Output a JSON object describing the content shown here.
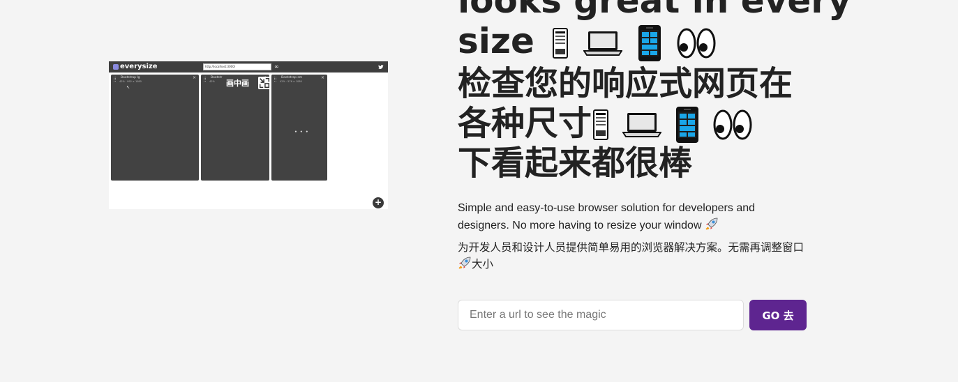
{
  "preview": {
    "logo": "everysize",
    "url": "http://localhost:3000/",
    "link_icon": "∞",
    "pip_label": "画中画",
    "add_label": "+",
    "cursor": "↖",
    "dots": "• • •",
    "panels": [
      {
        "name": "Bootstrap lg",
        "dims": "42%  ·  992  ×  1080",
        "close": "×"
      },
      {
        "name": "Bootstr",
        "dims": "42%",
        "close": "×"
      },
      {
        "name": "Bootstrap sm",
        "dims": "42%  ·  576  ×  1080",
        "close": "×"
      }
    ]
  },
  "hero": {
    "headline_line1": "looks great in every",
    "headline_line2": "size",
    "headline_zh_1": "检查您的响应式网页在",
    "headline_zh_2": "各种尺寸",
    "headline_zh_3": "下看起来都很棒",
    "icons": [
      "desktop-tower-icon",
      "laptop-icon",
      "mobile-phone-icon",
      "eyes-icon"
    ],
    "subtitle": "Simple and easy-to-use browser solution for developers and designers. No more having to resize your window",
    "subtitle_zh_1": "为开发人员和设计人员提供简单易用的浏览器解决方案。无需再调整窗口",
    "subtitle_zh_2": "大小"
  },
  "form": {
    "placeholder": "Enter a url to see the magic",
    "value": "",
    "go_label": "GO 去"
  },
  "colors": {
    "background": "#f4f4f4",
    "accent": "#5e2590",
    "dark_panel": "#424242"
  }
}
